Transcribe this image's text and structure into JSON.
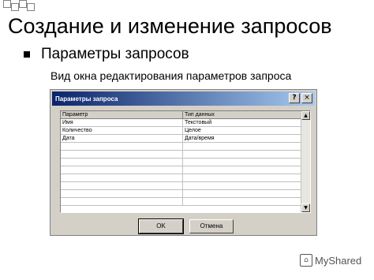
{
  "slide": {
    "title": "Создание и изменение запросов",
    "bullet": "Параметры запросов",
    "subtitle": "Вид окна редактирования параметров запроса"
  },
  "dialog": {
    "title": "Параметры запроса",
    "help_symbol": "?",
    "close_symbol": "×",
    "columns": [
      "Параметр",
      "Тип данных"
    ],
    "rows": [
      [
        "Имя",
        "Текстовый"
      ],
      [
        "Количество",
        "Целое"
      ],
      [
        "Дата",
        "Дата/время"
      ],
      [
        "",
        ""
      ],
      [
        "",
        ""
      ],
      [
        "",
        ""
      ],
      [
        "",
        ""
      ],
      [
        "",
        ""
      ],
      [
        "",
        ""
      ],
      [
        "",
        ""
      ],
      [
        "",
        ""
      ]
    ],
    "scroll_up": "▲",
    "scroll_down": "▼",
    "ok_label": "OK",
    "cancel_label": "Отмена"
  },
  "watermark": {
    "icon": "⌂",
    "text": "MyShared"
  }
}
